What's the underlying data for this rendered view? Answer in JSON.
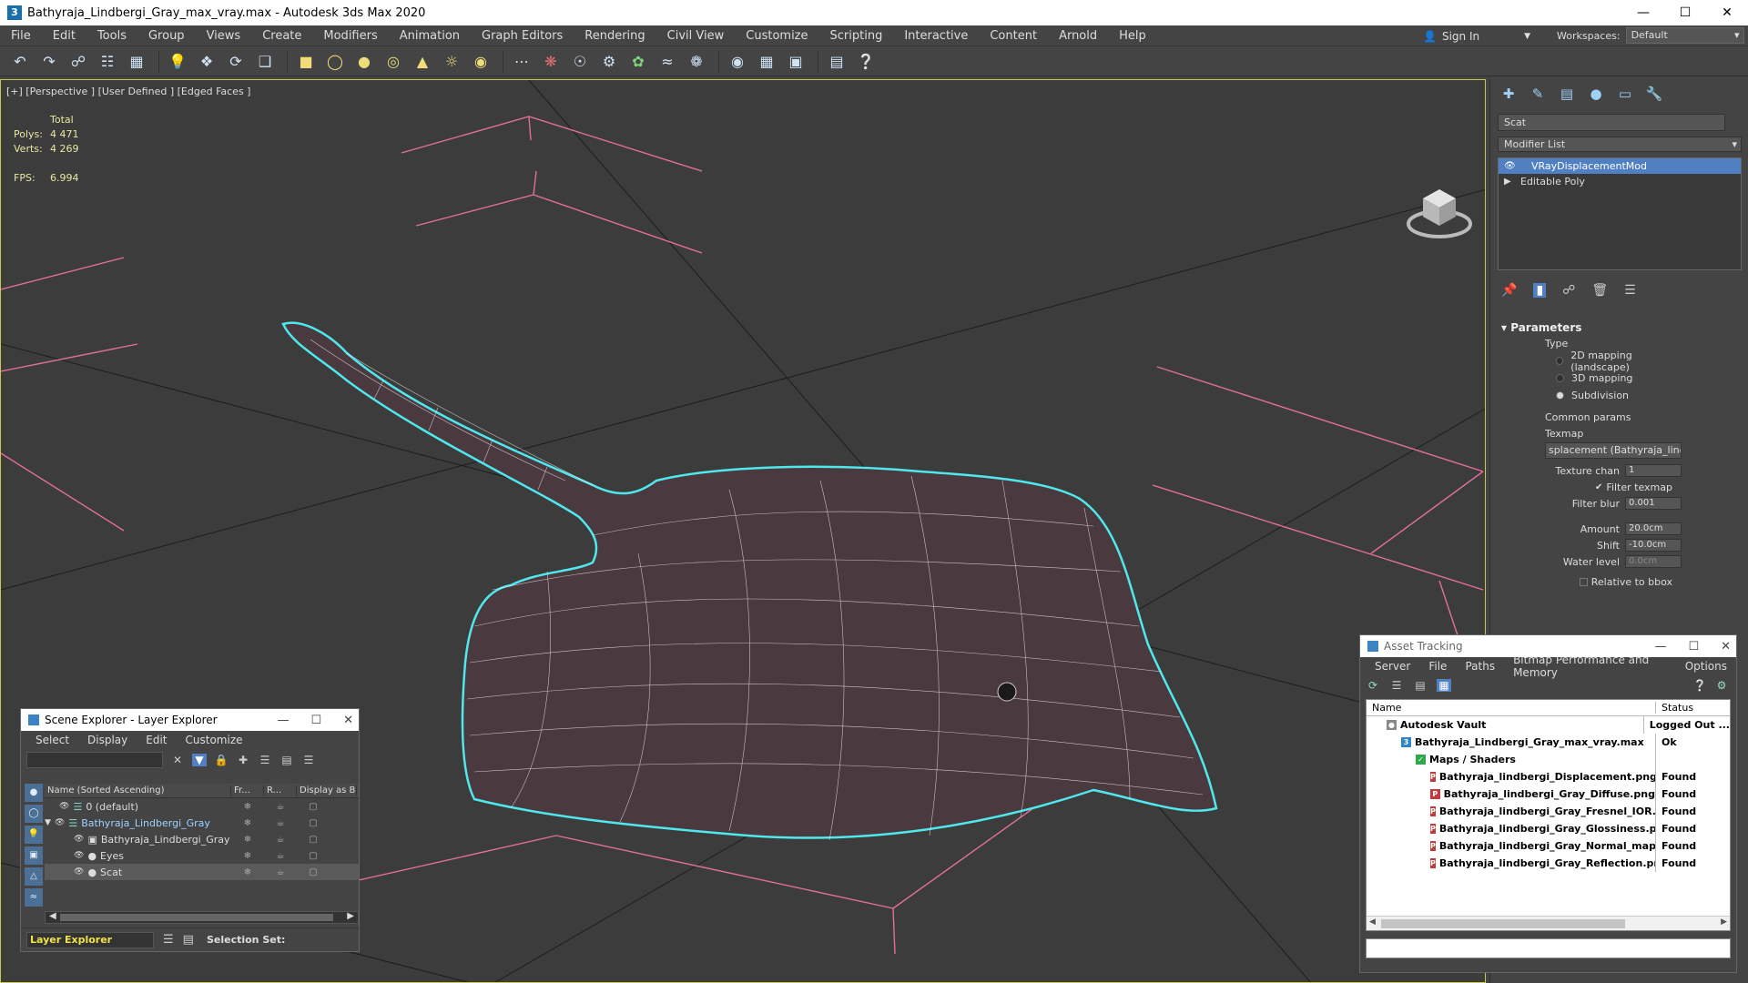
{
  "window": {
    "title": "Bathyraja_Lindbergi_Gray_max_vray.max - Autodesk 3ds Max 2020",
    "app_icon": "3"
  },
  "menu": [
    "File",
    "Edit",
    "Tools",
    "Group",
    "Views",
    "Create",
    "Modifiers",
    "Animation",
    "Graph Editors",
    "Rendering",
    "Civil View",
    "Customize",
    "Scripting",
    "Interactive",
    "Content",
    "Arnold",
    "Help"
  ],
  "signin": {
    "label": "Sign In"
  },
  "workspaces": {
    "label": "Workspaces:",
    "value": "Default"
  },
  "viewport": {
    "label": "[+] [Perspective ] [User Defined ] [Edged Faces ]",
    "stats": {
      "total_label": "Total",
      "polys_label": "Polys:",
      "polys": "4 471",
      "verts_label": "Verts:",
      "verts": "4 269",
      "fps_label": "FPS:",
      "fps": "6.994"
    },
    "colors": {
      "grid": "#e0709a",
      "selection": "#4fe8ec",
      "wire": "#f3eaf1",
      "model": "#4a3a40"
    }
  },
  "command_panel": {
    "object_name": "Scat",
    "modifier_list": "Modifier List",
    "stack": [
      {
        "label": "VRayDisplacementMod",
        "selected": true
      },
      {
        "label": "Editable Poly",
        "selected": false
      }
    ],
    "parameters": {
      "title": "Parameters",
      "type_label": "Type",
      "types": [
        {
          "label": "2D mapping (landscape)",
          "on": false
        },
        {
          "label": "3D mapping",
          "on": false
        },
        {
          "label": "Subdivision",
          "on": true
        }
      ],
      "common_label": "Common params",
      "texmap_label": "Texmap",
      "texmap_value": "splacement (Bathyraja_lindbe",
      "texture_chan_label": "Texture chan",
      "texture_chan": "1",
      "filter_texmap_label": "Filter texmap",
      "filter_blur_label": "Filter blur",
      "filter_blur": "0.001",
      "amount_label": "Amount",
      "amount": "20.0cm",
      "shift_label": "Shift",
      "shift": "-10.0cm",
      "water_level_label": "Water level",
      "water_level": "0.0cm",
      "relative_label": "Relative to bbox"
    }
  },
  "scene_explorer": {
    "title": "Scene Explorer - Layer Explorer",
    "menu": [
      "Select",
      "Display",
      "Edit",
      "Customize"
    ],
    "columns": [
      "Name (Sorted Ascending)",
      "Fr...",
      "R...",
      "Display as Bo:"
    ],
    "rows": [
      {
        "name": "0 (default)",
        "indent": 1,
        "selected": false,
        "highlight": false
      },
      {
        "name": "Bathyraja_Lindbergi_Gray",
        "indent": 0,
        "selected": false,
        "highlight": true
      },
      {
        "name": "Bathyraja_Lindbergi_Gray",
        "indent": 2,
        "selected": false,
        "highlight": false
      },
      {
        "name": "Eyes",
        "indent": 2,
        "selected": false,
        "highlight": false
      },
      {
        "name": "Scat",
        "indent": 2,
        "selected": true,
        "highlight": false
      }
    ],
    "footer": {
      "layer_explorer": "Layer Explorer",
      "selection_set": "Selection Set:"
    }
  },
  "asset_tracking": {
    "title": "Asset Tracking",
    "menu": [
      "Server",
      "File",
      "Paths",
      "Bitmap Performance and Memory",
      "Options"
    ],
    "columns": {
      "name": "Name",
      "status": "Status"
    },
    "rows": [
      {
        "name": "Autodesk Vault",
        "status": "Logged Out ...",
        "indent": 1,
        "icon": "vault"
      },
      {
        "name": "Bathyraja_Lindbergi_Gray_max_vray.max",
        "status": "Ok",
        "indent": 2,
        "icon": "max"
      },
      {
        "name": "Maps / Shaders",
        "status": "",
        "indent": 3,
        "icon": "maps"
      },
      {
        "name": "Bathyraja_lindbergi_Displacement.png",
        "status": "Found",
        "indent": 4,
        "icon": "png"
      },
      {
        "name": "Bathyraja_lindbergi_Gray_Diffuse.png",
        "status": "Found",
        "indent": 4,
        "icon": "png"
      },
      {
        "name": "Bathyraja_lindbergi_Gray_Fresnel_IOR.png",
        "status": "Found",
        "indent": 4,
        "icon": "png"
      },
      {
        "name": "Bathyraja_lindbergi_Gray_Glossiness.png",
        "status": "Found",
        "indent": 4,
        "icon": "png"
      },
      {
        "name": "Bathyraja_lindbergi_Gray_Normal_map.png",
        "status": "Found",
        "indent": 4,
        "icon": "png"
      },
      {
        "name": "Bathyraja_lindbergi_Gray_Reflection.png",
        "status": "Found",
        "indent": 4,
        "icon": "png"
      }
    ]
  }
}
